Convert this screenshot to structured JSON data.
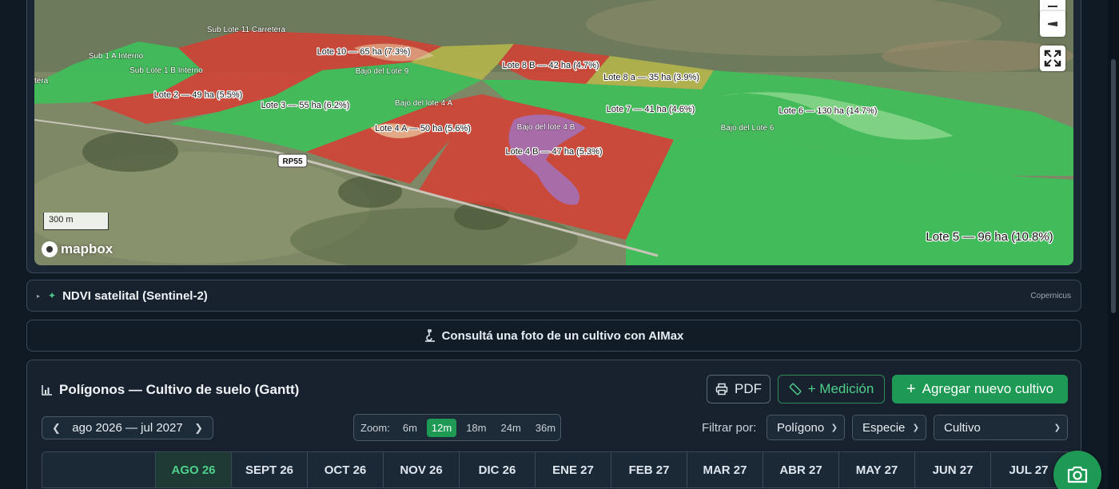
{
  "map": {
    "scale": "300 m",
    "attribution": "mapbox",
    "road": "RP55",
    "lots": [
      {
        "label": "Sub Lote 11 Carretera"
      },
      {
        "label": "Lote 10 — 65 ha (7.3%)"
      },
      {
        "label": "Sub 1 A Interno"
      },
      {
        "label": "Sub Lote 1 B Interno"
      },
      {
        "label": "Bajo del Lote 9"
      },
      {
        "label": "Lote 8 B — 42 ha (4.7%)"
      },
      {
        "label": "Lote 8 a — 35 ha (3.9%)"
      },
      {
        "label": "Lote 2 — 49 ha (5.5%)"
      },
      {
        "label": "Lote 3 — 55 ha (6.2%)"
      },
      {
        "label": "Bajo del lote 4 A"
      },
      {
        "label": "Lote 7 — 41 ha (4.6%)"
      },
      {
        "label": "Lote 6 — 130 ha (14.7%)"
      },
      {
        "label": "Bajo del Lote 6"
      },
      {
        "label": "Lote 4 A — 50 ha (5.6%)"
      },
      {
        "label": "Bajo del lote 4 B"
      },
      {
        "label": "Lote 4 B — 47 ha (5.3%)"
      },
      {
        "label": "Lote 5 — 96 ha (10.8%)"
      },
      {
        "label": "tera"
      }
    ]
  },
  "ndvi": {
    "label": "NDVI satelital (Sentinel-2)",
    "source": "Copernicus"
  },
  "aimax": {
    "label": "Consultá una foto de un cultivo con AIMax"
  },
  "gantt": {
    "title": "Polígonos — Cultivo de suelo (Gantt)",
    "pdf_label": "PDF",
    "medicion_label": "+ Medición",
    "add_label": "Agregar nuevo cultivo",
    "period": "ago 2026 — jul 2027",
    "zoom_label": "Zoom:",
    "zoom_options": [
      "6m",
      "12m",
      "18m",
      "24m",
      "36m"
    ],
    "zoom_active": "12m",
    "filter_label": "Filtrar por:",
    "filter_polygon": "Polígono",
    "filter_species": "Especie",
    "filter_crop": "Cultivo",
    "months": [
      "AGO 26",
      "SEPT 26",
      "OCT 26",
      "NOV 26",
      "DIC 26",
      "ENE 27",
      "FEB 27",
      "MAR 27",
      "ABR 27",
      "MAY 27",
      "JUN 27",
      "JUL 27"
    ]
  },
  "colors": {
    "accent": "#1f9a55",
    "lot_red": "#d43a32",
    "lot_green": "#35c44a"
  }
}
